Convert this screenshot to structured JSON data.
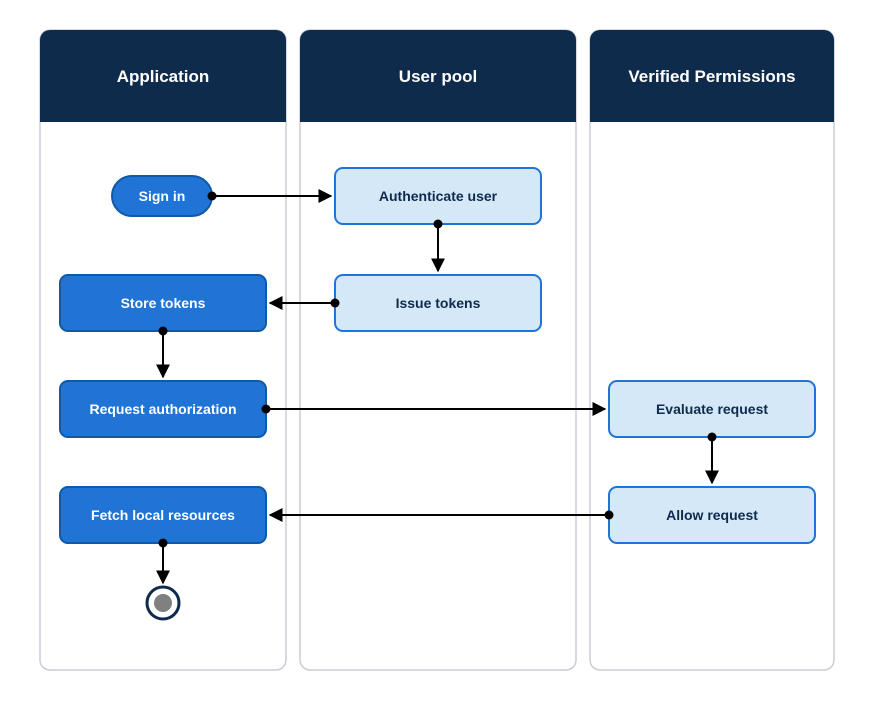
{
  "lanes": {
    "application": {
      "title": "Application"
    },
    "user_pool": {
      "title": "User pool"
    },
    "verified_permissions": {
      "title": "Verified Permissions"
    }
  },
  "nodes": {
    "sign_in": {
      "label": "Sign in"
    },
    "auth_user": {
      "label": "Authenticate user"
    },
    "issue_tokens": {
      "label": "Issue tokens"
    },
    "store_tokens": {
      "label": "Store tokens"
    },
    "request_auth": {
      "label": "Request authorization"
    },
    "evaluate_request": {
      "label": "Evaluate request"
    },
    "allow_request": {
      "label": "Allow request"
    },
    "fetch_resources": {
      "label": "Fetch local resources"
    }
  },
  "colors": {
    "lane_header_bg": "#0F2B4C",
    "lane_header_text": "#FFFFFF",
    "lane_border": "#C9CED6",
    "dark_box_bg": "#2074D5",
    "dark_box_border": "#1059A6",
    "dark_box_text": "#FFFFFF",
    "light_box_bg": "#D4E8F8",
    "light_box_border": "#2074D5",
    "light_box_text": "#0F2B4C",
    "arrow": "#000000",
    "end_circle_fill": "#808080",
    "end_circle_stroke": "#0F2B4C"
  }
}
